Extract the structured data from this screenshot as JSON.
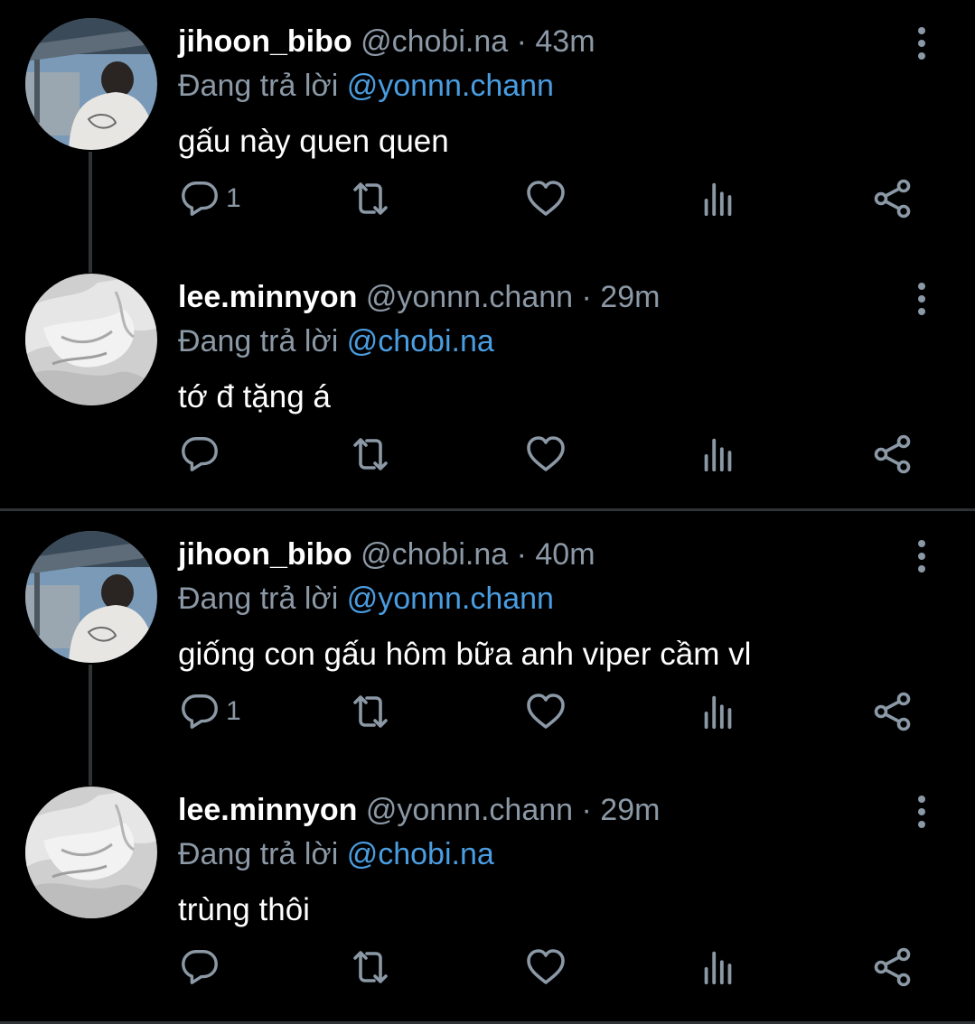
{
  "threads": [
    {
      "tweets": [
        {
          "display_name": "jihoon_bibo",
          "handle": "@chobi.na",
          "time": "· 43m",
          "replying_label": "Đang trả lời",
          "replying_to": "@yonnn.chann",
          "text": "gấu này quen quen",
          "reply_count": "1",
          "avatar": "jihoon-avatar"
        },
        {
          "display_name": "lee.minnyon",
          "handle": "@yonnn.chann",
          "time": "· 29m",
          "replying_label": "Đang trả lời",
          "replying_to": "@chobi.na",
          "text": "tớ đ tặng á",
          "reply_count": "",
          "avatar": "minnyon-avatar"
        }
      ]
    },
    {
      "tweets": [
        {
          "display_name": "jihoon_bibo",
          "handle": "@chobi.na",
          "time": "· 40m",
          "replying_label": "Đang trả lời",
          "replying_to": "@yonnn.chann",
          "text": "giống con gấu hôm bữa anh viper cầm vl",
          "reply_count": "1",
          "avatar": "jihoon-avatar"
        },
        {
          "display_name": "lee.minnyon",
          "handle": "@yonnn.chann",
          "time": "· 29m",
          "replying_label": "Đang trả lời",
          "replying_to": "@chobi.na",
          "text": "trùng thôi",
          "reply_count": "",
          "avatar": "minnyon-avatar"
        }
      ]
    }
  ],
  "icons": {
    "reply": "reply-icon",
    "retweet": "retweet-icon",
    "like": "heart-icon",
    "views": "analytics-icon",
    "share": "share-icon",
    "more": "more-vertical-icon"
  },
  "colors": {
    "background": "#000000",
    "text": "#ffffff",
    "secondary": "#8b98a5",
    "mention": "#4a9de0",
    "divider": "#2f3336"
  }
}
